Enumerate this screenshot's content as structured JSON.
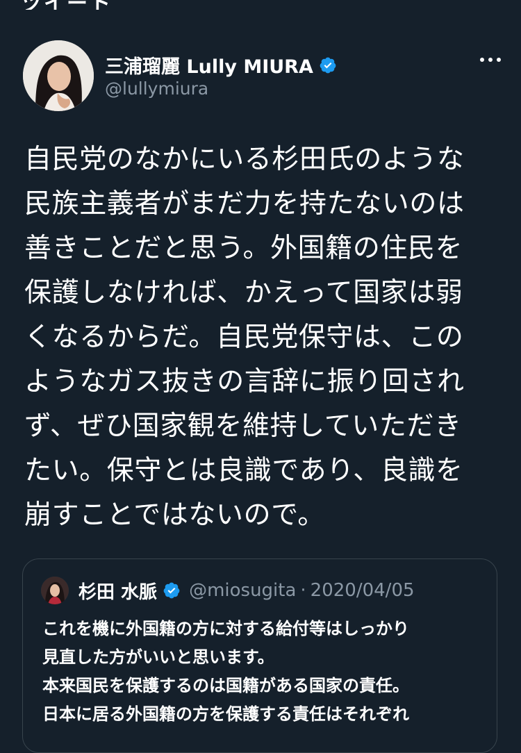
{
  "top_cut_text": "ツイート",
  "author": {
    "name": "三浦瑠麗 Lully MIURA",
    "handle": "@lullymiura"
  },
  "tweet": {
    "lines": [
      "自民党のなかにいる杉田氏のような",
      "民族主義者がまだ力を持たないのは",
      "善きことだと思う。外国籍の住民を",
      "保護しなければ、かえって国家は弱",
      "くなるからだ。自民党保守は、この",
      "ようなガス抜きの言辞に振り回され",
      "ず、ぜひ国家観を維持していただき",
      "たい。保守とは良識であり、良識を",
      "崩すことではないので。"
    ]
  },
  "quoted_tweet": {
    "name": "杉田 水脈",
    "handle": "@miosugita",
    "separator": "·",
    "date": "2020/04/05",
    "lines": [
      "これを機に外国籍の方に対する給付等はしっかり",
      "見直した方がいいと思います。",
      "本来国民を保護するのは国籍がある国家の責任。",
      "日本に居る外国籍の方を保護する責任はそれぞれ"
    ]
  },
  "colors": {
    "background": "#15202b",
    "text": "#ffffff",
    "secondary_text": "#8b98a5",
    "verified_badge": "#1d9bf0",
    "border": "#38444d"
  },
  "icons": {
    "verified": "verified-badge-icon",
    "more": "more-horizontal-icon"
  }
}
